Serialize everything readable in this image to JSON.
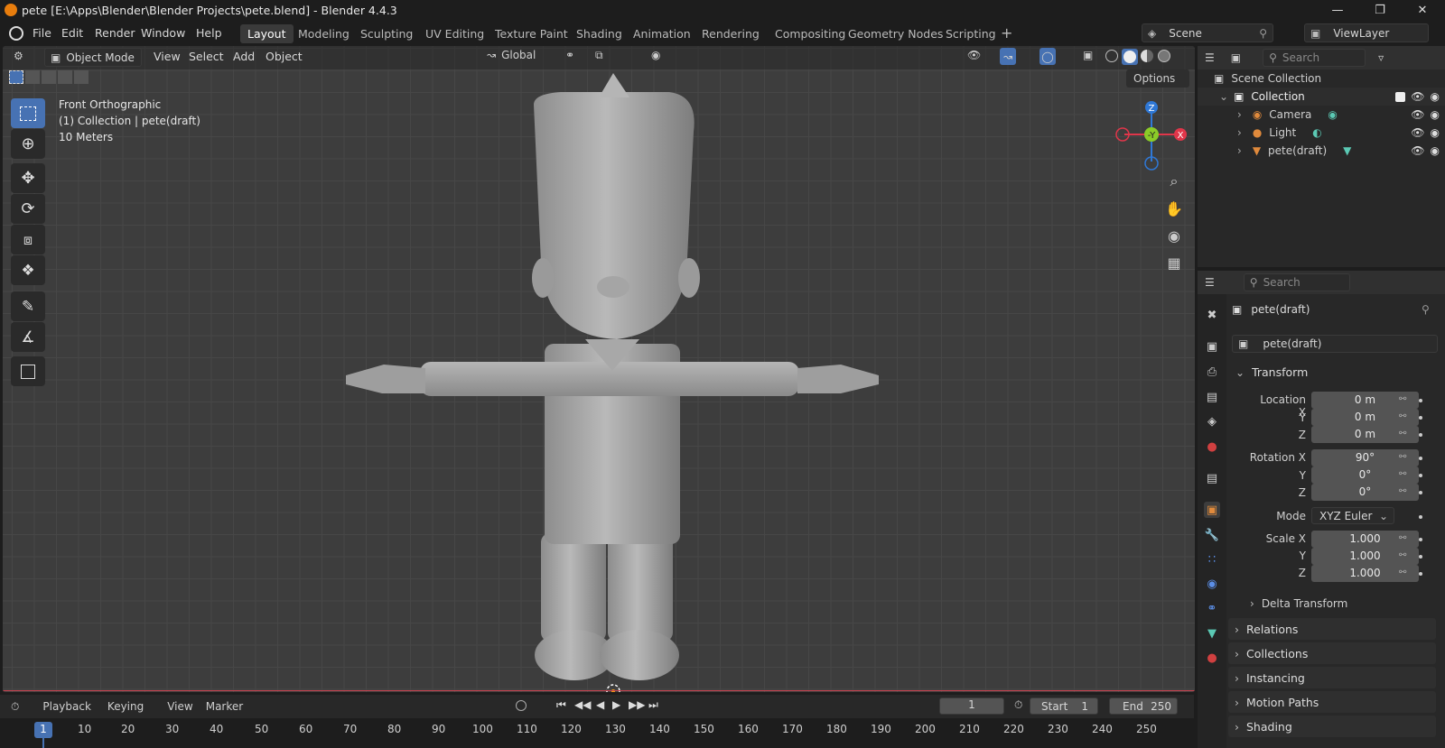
{
  "window": {
    "title": "pete [E:\\Apps\\Blender\\Blender Projects\\pete.blend] - Blender 4.4.3"
  },
  "menu": [
    "File",
    "Edit",
    "Render",
    "Window",
    "Help"
  ],
  "workspaces": [
    "Layout",
    "Modeling",
    "Sculpting",
    "UV Editing",
    "Texture Paint",
    "Shading",
    "Animation",
    "Rendering",
    "Compositing",
    "Geometry Nodes",
    "Scripting"
  ],
  "active_workspace": "Layout",
  "scene": {
    "name": "Scene",
    "view_layer": "ViewLayer"
  },
  "viewport_header": {
    "mode": "Object Mode",
    "view": "View",
    "select": "Select",
    "add": "Add",
    "object": "Object",
    "orientation": "Global",
    "options": "Options"
  },
  "viewport_info": {
    "line1": "Front Orthographic",
    "line2": "(1) Collection | pete(draft)",
    "line3": "10 Meters"
  },
  "gizmo": {
    "z": "Z",
    "y": "-Y",
    "x": "X"
  },
  "outliner": {
    "search_placeholder": "Search",
    "scene_collection": "Scene Collection",
    "collection": "Collection",
    "items": [
      "Camera",
      "Light",
      "pete(draft)"
    ]
  },
  "properties": {
    "search_placeholder": "Search",
    "object_name": "pete(draft)",
    "object_field": "pete(draft)",
    "transform": "Transform",
    "location_label": "Location X",
    "y_label": "Y",
    "z_label": "Z",
    "location": [
      "0 m",
      "0 m",
      "0 m"
    ],
    "rotation_label": "Rotation X",
    "rotation": [
      "90°",
      "0°",
      "0°"
    ],
    "mode_label": "Mode",
    "mode_value": "XYZ Euler",
    "scale_label": "Scale X",
    "scale": [
      "1.000",
      "1.000",
      "1.000"
    ],
    "delta": "Delta Transform",
    "panels": [
      "Relations",
      "Collections",
      "Instancing",
      "Motion Paths",
      "Shading"
    ]
  },
  "timeline": {
    "menus": [
      "Playback",
      "Keying",
      "View",
      "Marker"
    ],
    "current_frame": "1",
    "start_label": "Start",
    "start": "1",
    "end_label": "End",
    "end": "250",
    "ticks": [
      "1",
      "10",
      "20",
      "30",
      "40",
      "50",
      "60",
      "70",
      "80",
      "90",
      "100",
      "110",
      "120",
      "130",
      "140",
      "150",
      "160",
      "170",
      "180",
      "190",
      "200",
      "210",
      "220",
      "230",
      "240",
      "250"
    ]
  },
  "colors": {
    "accent": "#4772b3",
    "axis_x": "#e0364a",
    "axis_y": "#8bcc28",
    "axis_z": "#2f78d6"
  }
}
